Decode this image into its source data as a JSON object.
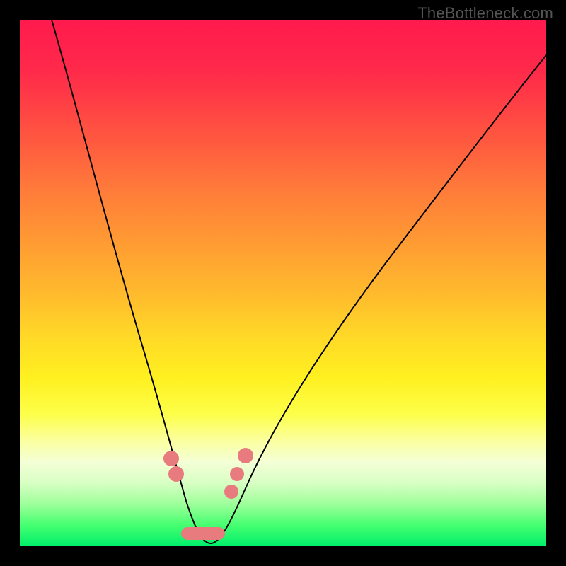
{
  "watermark": "TheBottleneck.com",
  "chart_data": {
    "type": "line",
    "title": "",
    "xlabel": "",
    "ylabel": "",
    "xlim": [
      0,
      100
    ],
    "ylim": [
      0,
      100
    ],
    "axes_visible": false,
    "grid": false,
    "background_gradient": {
      "direction": "vertical",
      "stops": [
        {
          "pos": 0,
          "color": "#ff1a4d"
        },
        {
          "pos": 25,
          "color": "#ff6a3d"
        },
        {
          "pos": 50,
          "color": "#ffc82a"
        },
        {
          "pos": 70,
          "color": "#fdff40"
        },
        {
          "pos": 85,
          "color": "#e6ffc4"
        },
        {
          "pos": 100,
          "color": "#00ef6b"
        }
      ]
    },
    "series": [
      {
        "name": "bottleneck-curve",
        "x": [
          6,
          10,
          14,
          18,
          22,
          26,
          28,
          30,
          32,
          34,
          36,
          38,
          40,
          44,
          50,
          58,
          70,
          84,
          100
        ],
        "y": [
          100,
          88,
          74,
          60,
          46,
          30,
          22,
          14,
          8,
          4,
          1,
          1,
          4,
          10,
          20,
          34,
          52,
          72,
          93
        ]
      }
    ],
    "markers": [
      {
        "name": "left-dot-upper",
        "x": 28.3,
        "y": 17.0,
        "r": 1.5
      },
      {
        "name": "left-dot-lower",
        "x": 29.1,
        "y": 14.0,
        "r": 1.5
      },
      {
        "name": "right-dot-upper",
        "x": 42.5,
        "y": 17.5,
        "r": 1.5
      },
      {
        "name": "right-dot-mid",
        "x": 41.0,
        "y": 13.8,
        "r": 1.4
      },
      {
        "name": "right-dot-lower",
        "x": 40.0,
        "y": 10.5,
        "r": 1.4
      }
    ],
    "trough_bar": {
      "x_start": 31,
      "x_end": 39,
      "y": 3.3,
      "thickness": 2.4,
      "color": "#e77b7e"
    }
  }
}
